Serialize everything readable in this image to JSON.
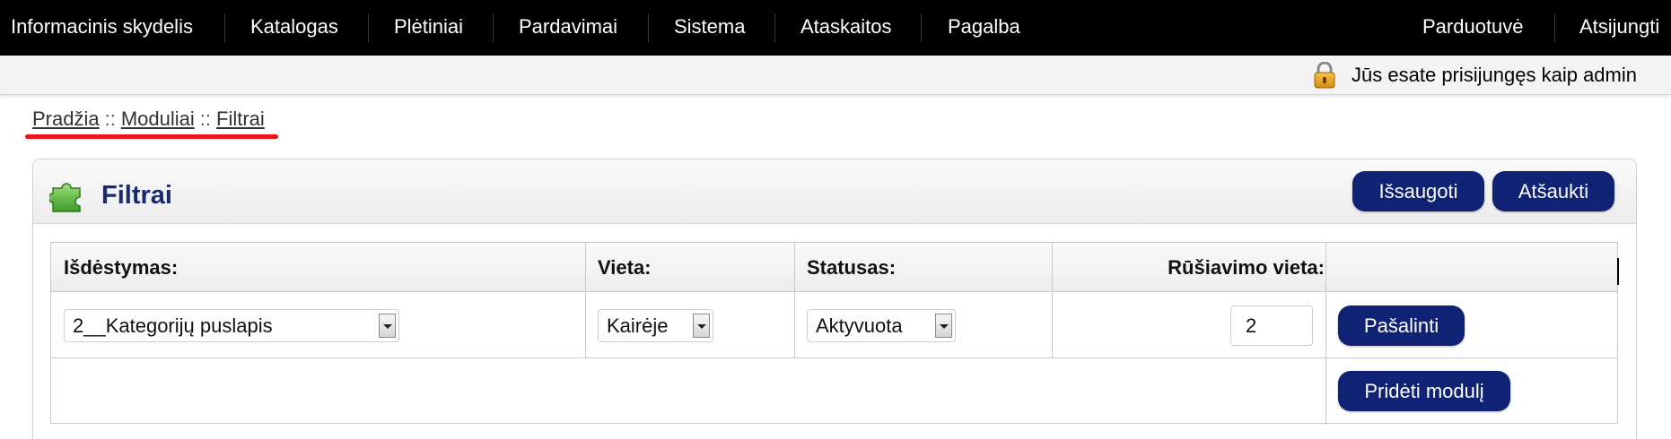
{
  "nav": {
    "left_items": [
      "Informacinis skydelis",
      "Katalogas",
      "Plėtiniai",
      "Pardavimai",
      "Sistema",
      "Ataskaitos",
      "Pagalba"
    ],
    "right_items": [
      "Parduotuvė",
      "Atsijungti"
    ]
  },
  "login": {
    "text": "Jūs esate prisijungęs kaip admin",
    "icon": "lock-icon"
  },
  "breadcrumb": {
    "items": [
      "Pradžia",
      "Moduliai",
      "Filtrai"
    ],
    "separator": "::"
  },
  "panel": {
    "title": "Filtrai",
    "icon": "puzzle-icon",
    "save_label": "Išsaugoti",
    "cancel_label": "Atšaukti"
  },
  "table": {
    "headers": {
      "layout": "Išdėstymas:",
      "position": "Vieta:",
      "status": "Statusas:",
      "sort_order": "Rūšiavimo vieta:",
      "actions": ""
    },
    "rows": [
      {
        "layout": "2__Kategorijų puslapis",
        "position": "Kairėje",
        "status": "Aktyvuota",
        "sort_order": "2",
        "remove_label": "Pašalinti"
      }
    ],
    "add_label": "Pridėti modulį"
  },
  "colors": {
    "nav_bg": "#000000",
    "button_bg": "#0f2274",
    "title": "#1a2a6e",
    "highlight": "#e8141b"
  }
}
